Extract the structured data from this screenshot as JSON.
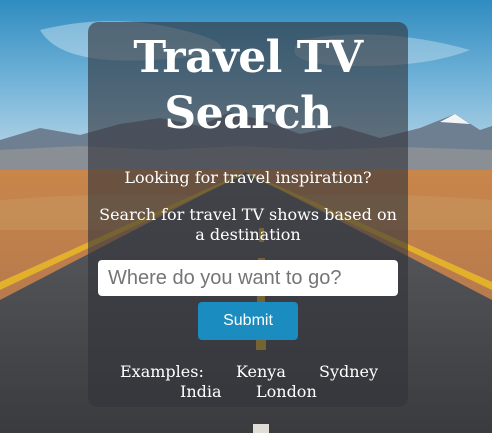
{
  "header": {
    "title_line1": "Travel TV",
    "title_line2": "Search"
  },
  "intro": {
    "line1": "Looking for travel inspiration?",
    "line2": "Search for travel TV shows based on a destination"
  },
  "search": {
    "placeholder": "Where do you want to go?",
    "value": ""
  },
  "submit_label": "Submit",
  "examples": {
    "label": "Examples:",
    "items": [
      "Kenya",
      "Sydney",
      "India",
      "London"
    ]
  },
  "colors": {
    "accent": "#1a8cbf",
    "panel": "#32343a"
  }
}
